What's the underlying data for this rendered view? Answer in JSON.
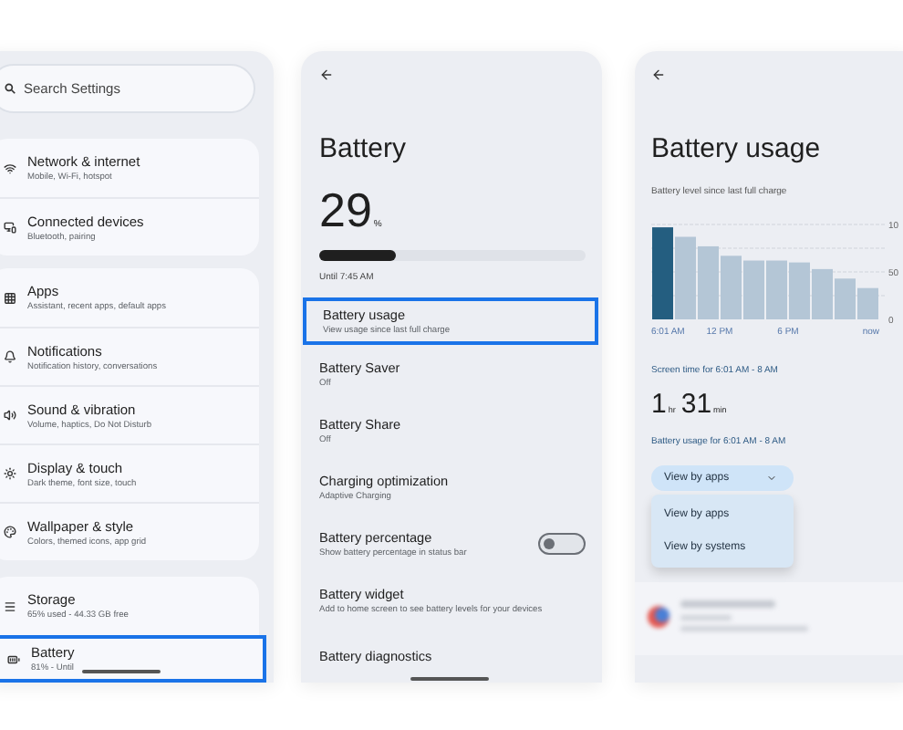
{
  "settings_screen": {
    "search": {
      "placeholder": "Search Settings"
    },
    "groups": [
      {
        "items": [
          {
            "title": "Network & internet",
            "subtitle": "Mobile, Wi-Fi, hotspot",
            "selected": false
          },
          {
            "title": "Connected devices",
            "subtitle": "Bluetooth, pairing",
            "selected": false
          }
        ]
      },
      {
        "items": [
          {
            "title": "Apps",
            "subtitle": "Assistant, recent apps, default apps",
            "selected": false
          },
          {
            "title": "Notifications",
            "subtitle": "Notification history, conversations",
            "selected": false
          },
          {
            "title": "Sound & vibration",
            "subtitle": "Volume, haptics, Do Not Disturb",
            "selected": false
          },
          {
            "title": "Display & touch",
            "subtitle": "Dark theme, font size, touch",
            "selected": false
          },
          {
            "title": "Wallpaper & style",
            "subtitle": "Colors, themed icons, app grid",
            "selected": false
          }
        ]
      },
      {
        "items": [
          {
            "title": "Storage",
            "subtitle": "65% used - 44.33 GB free",
            "selected": false
          },
          {
            "title": "Battery",
            "subtitle": "81% - Until",
            "selected": true
          }
        ]
      }
    ]
  },
  "battery_screen": {
    "title": "Battery",
    "percent": "29",
    "percent_sign": "%",
    "level": 0.29,
    "estimate": "Until 7:45 AM",
    "items": [
      {
        "kind": "link",
        "title": "Battery usage",
        "subtitle": "View usage since last full charge",
        "selected": true
      },
      {
        "kind": "link",
        "title": "Battery Saver",
        "subtitle": "Off",
        "selected": false
      },
      {
        "kind": "link",
        "title": "Battery Share",
        "subtitle": "Off",
        "selected": false
      },
      {
        "kind": "link",
        "title": "Charging optimization",
        "subtitle": "Adaptive Charging",
        "selected": false
      },
      {
        "kind": "toggle",
        "title": "Battery percentage",
        "subtitle": "Show battery percentage in status bar",
        "on": false,
        "selected": false
      },
      {
        "kind": "link",
        "title": "Battery widget",
        "subtitle": "Add to home screen to see battery levels for your devices",
        "selected": false
      },
      {
        "kind": "link",
        "title": "Battery diagnostics",
        "selected": false
      }
    ]
  },
  "usage_screen": {
    "title": "Battery usage",
    "chart_caption": "Battery level since last full charge",
    "chart_y_labels": [
      "10",
      "50",
      "0"
    ],
    "chart_x_labels": [
      "6:01 AM",
      "12 PM",
      "6 PM",
      "now"
    ],
    "screen_time_label": "Screen time for 6:01 AM - 8 AM",
    "hours": "1",
    "hours_unit": "hr",
    "minutes": "31",
    "minutes_unit": "min",
    "usage_label": "Battery usage for 6:01 AM - 8 AM",
    "dropdown": {
      "value": "View by apps",
      "expanded": true,
      "options": [
        "View by apps",
        "View by systems"
      ]
    }
  }
}
